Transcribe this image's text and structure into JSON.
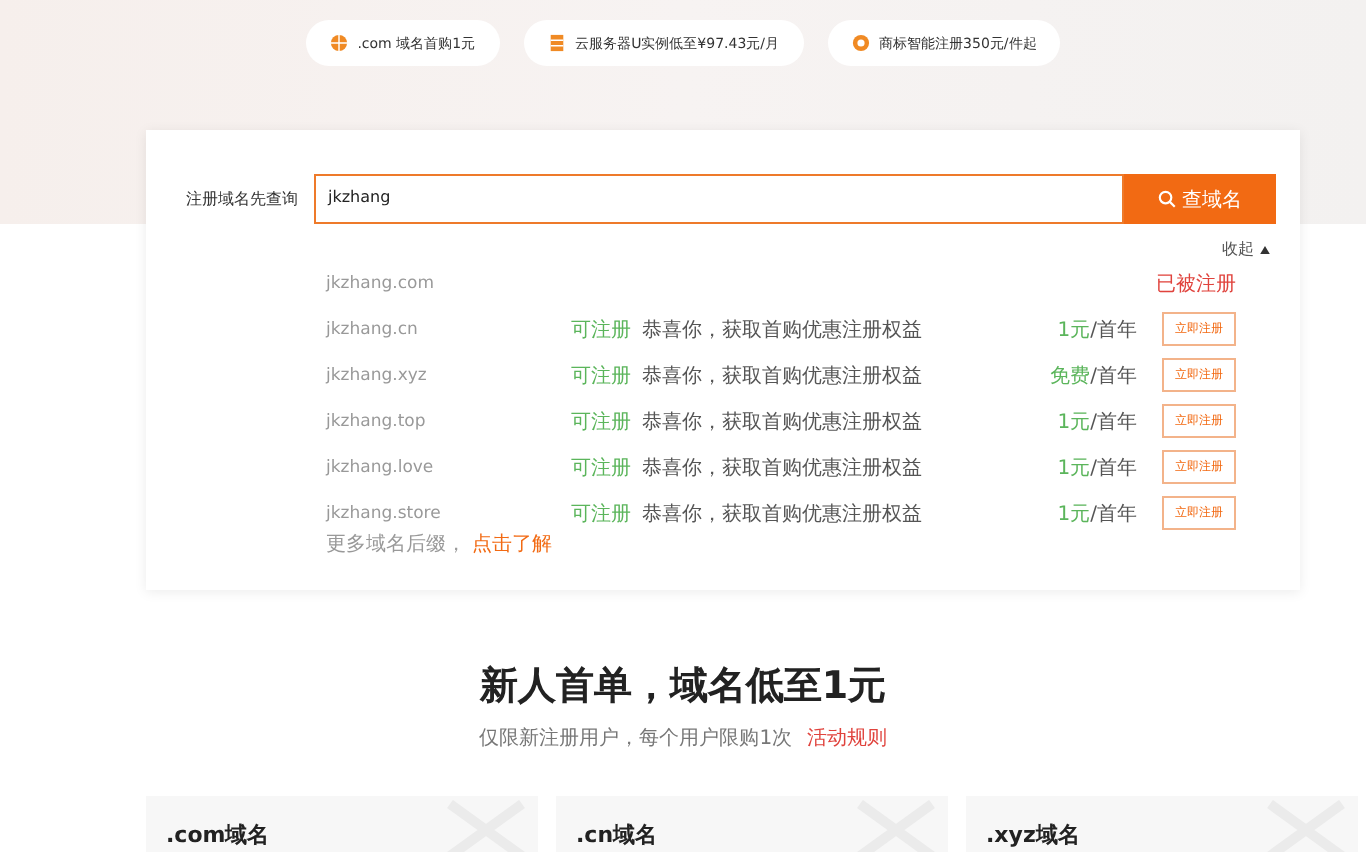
{
  "promos": [
    {
      "kind": "globe",
      "text": ".com 域名首购1元"
    },
    {
      "kind": "server",
      "text": "云服务器U实例低至¥97.43元/月"
    },
    {
      "kind": "badge",
      "text": "商标智能注册350元/件起"
    }
  ],
  "search": {
    "label": "注册域名先查询",
    "value": "jkzhang",
    "button": "查域名"
  },
  "collapse": {
    "label": "收起",
    "expanded": true
  },
  "results": [
    {
      "kind": "taken",
      "domain": "jkzhang.com",
      "status": "已被注册"
    },
    {
      "kind": "available",
      "domain": "jkzhang.cn",
      "status": "可注册",
      "message": "恭喜你，获取首购优惠注册权益",
      "price": "1元",
      "unit": "/首年",
      "button": "立即注册"
    },
    {
      "kind": "available",
      "domain": "jkzhang.xyz",
      "status": "可注册",
      "message": "恭喜你，获取首购优惠注册权益",
      "price": "免费",
      "unit": "/首年",
      "button": "立即注册"
    },
    {
      "kind": "available",
      "domain": "jkzhang.top",
      "status": "可注册",
      "message": "恭喜你，获取首购优惠注册权益",
      "price": "1元",
      "unit": "/首年",
      "button": "立即注册"
    },
    {
      "kind": "available",
      "domain": "jkzhang.love",
      "status": "可注册",
      "message": "恭喜你，获取首购优惠注册权益",
      "price": "1元",
      "unit": "/首年",
      "button": "立即注册"
    },
    {
      "kind": "available",
      "domain": "jkzhang.store",
      "status": "可注册",
      "message": "恭喜你，获取首购优惠注册权益",
      "price": "1元",
      "unit": "/首年",
      "button": "立即注册"
    }
  ],
  "more": {
    "text": "更多域名后缀，",
    "link": "点击了解"
  },
  "promo_section": {
    "title": "新人首单，域名低至1元",
    "subtitle": "仅限新注册用户，每个用户限购1次",
    "link": "活动规则"
  },
  "cards": [
    {
      "title": ".com域名"
    },
    {
      "title": ".cn域名"
    },
    {
      "title": ".xyz域名"
    }
  ]
}
